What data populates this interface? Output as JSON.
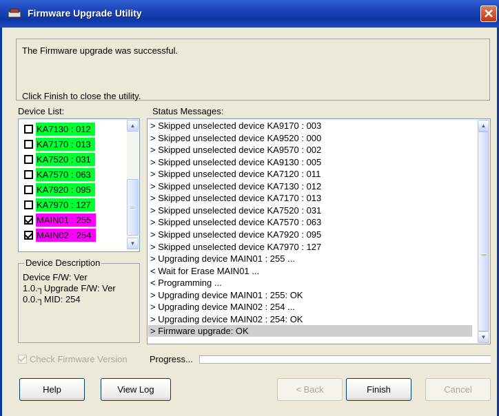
{
  "window": {
    "title": "Firmware Upgrade Utility",
    "close_label": "✕"
  },
  "message": {
    "line1": "The Firmware upgrade was successful.",
    "line2": "Click Finish to close the utility."
  },
  "device_list": {
    "label": "Device List:",
    "items": [
      {
        "label": "KA7130 : 012",
        "checked": false,
        "color": "#00ff33"
      },
      {
        "label": "KA7170 : 013",
        "checked": false,
        "color": "#00ff33"
      },
      {
        "label": "KA7520 : 031",
        "checked": false,
        "color": "#00ff33"
      },
      {
        "label": "KA7570 : 063",
        "checked": false,
        "color": "#00ff33"
      },
      {
        "label": "KA7920 : 095",
        "checked": false,
        "color": "#00ff33"
      },
      {
        "label": "KA7970 : 127",
        "checked": false,
        "color": "#00ff33"
      },
      {
        "label": "MAIN01 : 255",
        "checked": true,
        "color": "#ff00ff"
      },
      {
        "label": "MAIN02 : 254",
        "checked": true,
        "color": "#ff00ff"
      }
    ]
  },
  "device_description": {
    "title": "Device Description",
    "text": "Device F/W: Ver 1.0.┐Upgrade F/W: Ver 0.0.┐MID: 254"
  },
  "status": {
    "label": "Status Messages:",
    "lines": [
      "> Skipped unselected device KA9170 : 003",
      "> Skipped unselected device KA9520 : 000",
      "> Skipped unselected device KA9570 : 002",
      "> Skipped unselected device KA9130 : 005",
      "> Skipped unselected device KA7120 : 011",
      "> Skipped unselected device KA7130 : 012",
      "> Skipped unselected device KA7170 : 013",
      "> Skipped unselected device KA7520 : 031",
      "> Skipped unselected device KA7570 : 063",
      "> Skipped unselected device KA7920 : 095",
      "> Skipped unselected device KA7970 : 127",
      "> Upgrading device MAIN01 : 255 ...",
      "< Wait for Erase MAIN01 ...",
      "< Programming ...",
      "> Upgrading device MAIN01 : 255: OK",
      "> Upgrading device MAIN02 : 254 ...",
      "> Upgrading device MAIN02 : 254: OK",
      "> Firmware upgrade: OK"
    ],
    "selected_index": 17
  },
  "check_firmware": {
    "label": "Check Firmware Version",
    "checked": true,
    "enabled": false
  },
  "progress": {
    "label": "Progress...",
    "value": 0
  },
  "buttons": {
    "help": "Help",
    "view_log": "View Log",
    "back": "< Back",
    "finish": "Finish",
    "cancel": "Cancel"
  }
}
